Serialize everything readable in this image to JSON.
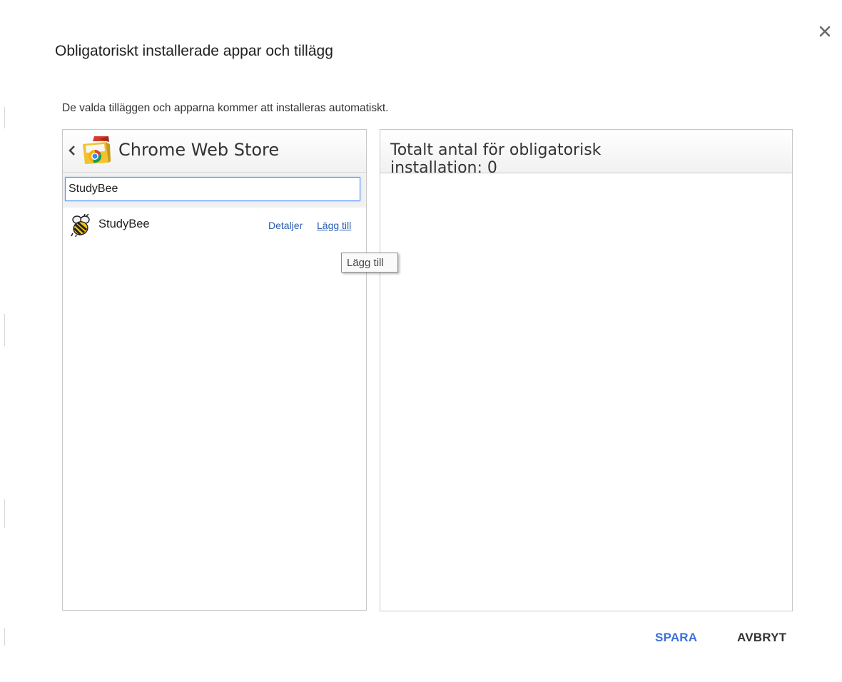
{
  "dialog": {
    "title": "Obligatoriskt installerade appar och tillägg",
    "description": "De valda tilläggen och apparna kommer att installeras automatiskt.",
    "close_icon": "close-icon"
  },
  "store": {
    "back_icon": "chevron-left-icon",
    "logo_icon": "chrome-web-store-icon",
    "title": "Chrome Web Store",
    "search": {
      "value": "StudyBee",
      "placeholder": ""
    },
    "results": [
      {
        "icon": "bee-icon",
        "name": "StudyBee",
        "details_label": "Detaljer",
        "add_label": "Lägg till"
      }
    ]
  },
  "tooltip": {
    "text": "Lägg till"
  },
  "selected_panel": {
    "title": "Totalt antal för obligatorisk installation: 0"
  },
  "footer": {
    "save_label": "SPARA",
    "cancel_label": "AVBRYT"
  },
  "colors": {
    "accent_blue": "#3d6fd9",
    "link_blue": "#2a5db0",
    "focus_blue": "#4d90fe"
  }
}
